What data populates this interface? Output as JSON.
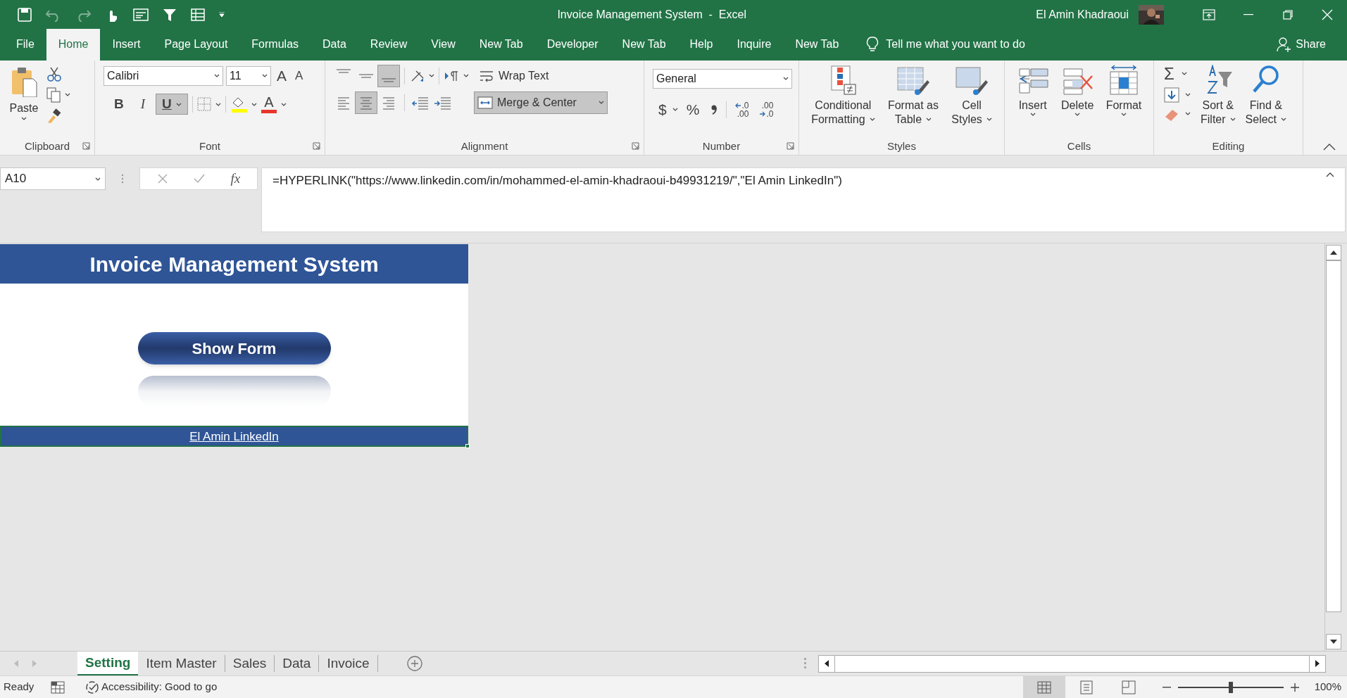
{
  "window": {
    "title": "Invoice Management System  -  Excel",
    "user": "El Amin Khadraoui"
  },
  "ribbon_tabs": [
    {
      "label": "File",
      "selected": false
    },
    {
      "label": "Home",
      "selected": true
    },
    {
      "label": "Insert",
      "selected": false
    },
    {
      "label": "Page Layout",
      "selected": false
    },
    {
      "label": "Formulas",
      "selected": false
    },
    {
      "label": "Data",
      "selected": false
    },
    {
      "label": "Review",
      "selected": false
    },
    {
      "label": "View",
      "selected": false
    },
    {
      "label": "New Tab",
      "selected": false
    },
    {
      "label": "Developer",
      "selected": false
    },
    {
      "label": "New Tab",
      "selected": false
    },
    {
      "label": "Help",
      "selected": false
    },
    {
      "label": "Inquire",
      "selected": false
    },
    {
      "label": "New Tab",
      "selected": false
    }
  ],
  "tell_me": "Tell me what you want to do",
  "share": "Share",
  "ribbon": {
    "clipboard": {
      "label": "Clipboard",
      "paste": "Paste"
    },
    "font": {
      "label": "Font",
      "font_name": "Calibri",
      "font_size": "11",
      "grow": "A",
      "shrink": "A",
      "font_color": "A",
      "styles": [
        {
          "kind": "bold",
          "label": "B",
          "selected": false
        },
        {
          "kind": "italic",
          "label": "I",
          "selected": false
        },
        {
          "kind": "underline",
          "label": "U",
          "selected": true
        }
      ]
    },
    "alignment": {
      "label": "Alignment",
      "wrap_text": "Wrap Text",
      "merge": "Merge & Center",
      "vertical": [
        {
          "kind": "top",
          "selected": false
        },
        {
          "kind": "middle",
          "selected": false
        },
        {
          "kind": "bottom",
          "selected": true
        }
      ],
      "horizontal": [
        {
          "kind": "left",
          "selected": false
        },
        {
          "kind": "center",
          "selected": true
        },
        {
          "kind": "right",
          "selected": false
        }
      ]
    },
    "number": {
      "label": "Number",
      "format": "General",
      "currency": "$",
      "percent": "%",
      "increase_decimal": [
        ".0",
        ".00"
      ],
      "decrease_decimal": [
        ".00",
        ".0"
      ]
    },
    "styles": {
      "label": "Styles",
      "buttons": [
        {
          "kind": "conditional",
          "lines": [
            "Conditional",
            "Formatting"
          ]
        },
        {
          "kind": "table",
          "lines": [
            "Format as",
            "Table"
          ]
        },
        {
          "kind": "cell",
          "lines": [
            "Cell",
            "Styles"
          ]
        }
      ]
    },
    "cells": {
      "label": "Cells",
      "buttons": [
        {
          "kind": "insert",
          "label": "Insert"
        },
        {
          "kind": "delete",
          "label": "Delete"
        },
        {
          "kind": "format",
          "label": "Format"
        }
      ]
    },
    "editing": {
      "label": "Editing",
      "autosum": "Σ",
      "buttons": [
        {
          "kind": "sort",
          "lines": [
            "Sort &",
            "Filter"
          ]
        },
        {
          "kind": "find",
          "lines": [
            "Find &",
            "Select"
          ]
        }
      ]
    }
  },
  "formula_bar": {
    "name_box": "A10",
    "function": "fx",
    "formula": "=HYPERLINK(\"https://www.linkedin.com/in/mohammed-el-amin-khadraoui-b49931219/\",\"El Amin LinkedIn\")"
  },
  "sheet": {
    "header": "Invoice Management System",
    "form_button": "Show Form",
    "link": "El Amin LinkedIn",
    "link_selected": true
  },
  "sheet_tabs": [
    {
      "label": "Setting",
      "selected": true
    },
    {
      "label": "Item Master",
      "selected": false
    },
    {
      "label": "Sales",
      "selected": false
    },
    {
      "label": "Data",
      "selected": false
    },
    {
      "label": "Invoice",
      "selected": false
    }
  ],
  "status_bar": {
    "ready": "Ready",
    "accessibility": "Accessibility: Good to go",
    "views": [
      {
        "kind": "normal",
        "selected": true
      },
      {
        "kind": "page_layout",
        "selected": false
      },
      {
        "kind": "page_break",
        "selected": false
      }
    ],
    "zoom": {
      "level": 0.5,
      "reading": "100%"
    }
  }
}
